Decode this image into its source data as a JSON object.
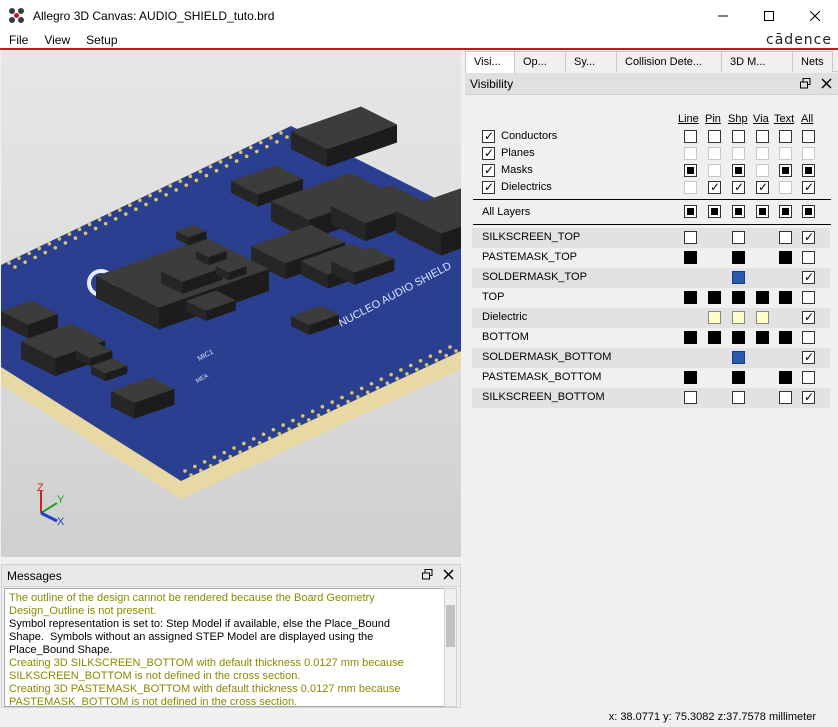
{
  "window": {
    "title": "Allegro 3D Canvas: AUDIO_SHIELD_tuto.brd",
    "controls": {
      "minimize": "—",
      "maximize": "☐",
      "close": "✕"
    }
  },
  "menu": {
    "items": [
      "File",
      "View",
      "Setup"
    ],
    "brand": "cādence"
  },
  "viewport": {
    "axis": {
      "z": "Z",
      "y": "Y",
      "x": "X"
    },
    "board": {
      "silk_text": "NUCLEO AUDIO SHIELD",
      "mic": "MIC1",
      "small": "MEA"
    }
  },
  "messages": {
    "title": "Messages",
    "lines": [
      {
        "text": "The outline of the design cannot be rendered because the Board Geometry",
        "color": "#8a8a00"
      },
      {
        "text": "Design_Outline is not present.",
        "color": "#8a8a00"
      },
      {
        "text": "Symbol representation is set to: Step Model if available, else the Place_Bound",
        "color": "#000000"
      },
      {
        "text": "Shape.  Symbols without an assigned STEP Model are displayed using the",
        "color": "#000000"
      },
      {
        "text": "Place_Bound Shape.",
        "color": "#000000"
      },
      {
        "text": "Creating 3D SILKSCREEN_BOTTOM with default thickness 0.0127 mm because",
        "color": "#8a8a00"
      },
      {
        "text": "SILKSCREEN_BOTTOM is not defined in the cross section.",
        "color": "#8a8a00"
      },
      {
        "text": "Creating 3D PASTEMASK_BOTTOM with default thickness 0.0127 mm because",
        "color": "#8a8a00"
      },
      {
        "text": "PASTEMASK_BOTTOM is not defined in the cross section.",
        "color": "#8a8a00"
      }
    ]
  },
  "status": {
    "coords": "x: 38.0771 y: 75.3082 z:37.7578 millimeter"
  },
  "tabs": [
    {
      "label": "Visi...",
      "active": true
    },
    {
      "label": "Op...",
      "active": false
    },
    {
      "label": "Sy...",
      "active": false
    },
    {
      "label": "Collision Dete...",
      "active": false
    },
    {
      "label": "3D M...",
      "active": false
    },
    {
      "label": "Nets",
      "active": false
    }
  ],
  "visibility": {
    "title": "Visibility",
    "columns": [
      "Line",
      "Pin",
      "Shp",
      "Via",
      "Text",
      "All"
    ],
    "groups": [
      {
        "label": "Conductors",
        "checked": true,
        "cells": [
          "empty",
          "empty",
          "empty",
          "empty",
          "empty",
          "empty"
        ]
      },
      {
        "label": "Planes",
        "checked": true,
        "cells": [
          "dim",
          "dim",
          "dim",
          "dim",
          "dim",
          "dim"
        ]
      },
      {
        "label": "Masks",
        "checked": true,
        "cells": [
          "fill",
          "dim",
          "fill",
          "dim",
          "fill",
          "fill"
        ]
      },
      {
        "label": "Dielectrics",
        "checked": true,
        "cells": [
          "dim",
          "check",
          "check",
          "check",
          "dim",
          "check"
        ]
      }
    ],
    "all_layers": {
      "label": "All Layers",
      "cells": [
        "fill",
        "fill",
        "fill",
        "fill",
        "fill",
        "fill"
      ]
    },
    "layers": [
      {
        "name": "SILKSCREEN_TOP",
        "cells": [
          "empty",
          "none",
          "empty",
          "none",
          "empty",
          "check"
        ]
      },
      {
        "name": "PASTEMASK_TOP",
        "cells": [
          "black",
          "none",
          "black",
          "none",
          "black",
          "empty"
        ]
      },
      {
        "name": "SOLDERMASK_TOP",
        "cells": [
          "none",
          "none",
          "blue",
          "none",
          "none",
          "check"
        ]
      },
      {
        "name": "TOP",
        "cells": [
          "black",
          "black",
          "black",
          "black",
          "black",
          "empty"
        ]
      },
      {
        "name": "Dielectric",
        "cells": [
          "none",
          "cream",
          "cream",
          "cream",
          "none",
          "check"
        ]
      },
      {
        "name": "BOTTOM",
        "cells": [
          "black",
          "black",
          "black",
          "black",
          "black",
          "empty"
        ]
      },
      {
        "name": "SOLDERMASK_BOTTOM",
        "cells": [
          "none",
          "none",
          "blue",
          "none",
          "none",
          "check"
        ]
      },
      {
        "name": "PASTEMASK_BOTTOM",
        "cells": [
          "black",
          "none",
          "black",
          "none",
          "black",
          "empty"
        ]
      },
      {
        "name": "SILKSCREEN_BOTTOM",
        "cells": [
          "empty",
          "none",
          "empty",
          "none",
          "empty",
          "check"
        ]
      }
    ]
  }
}
